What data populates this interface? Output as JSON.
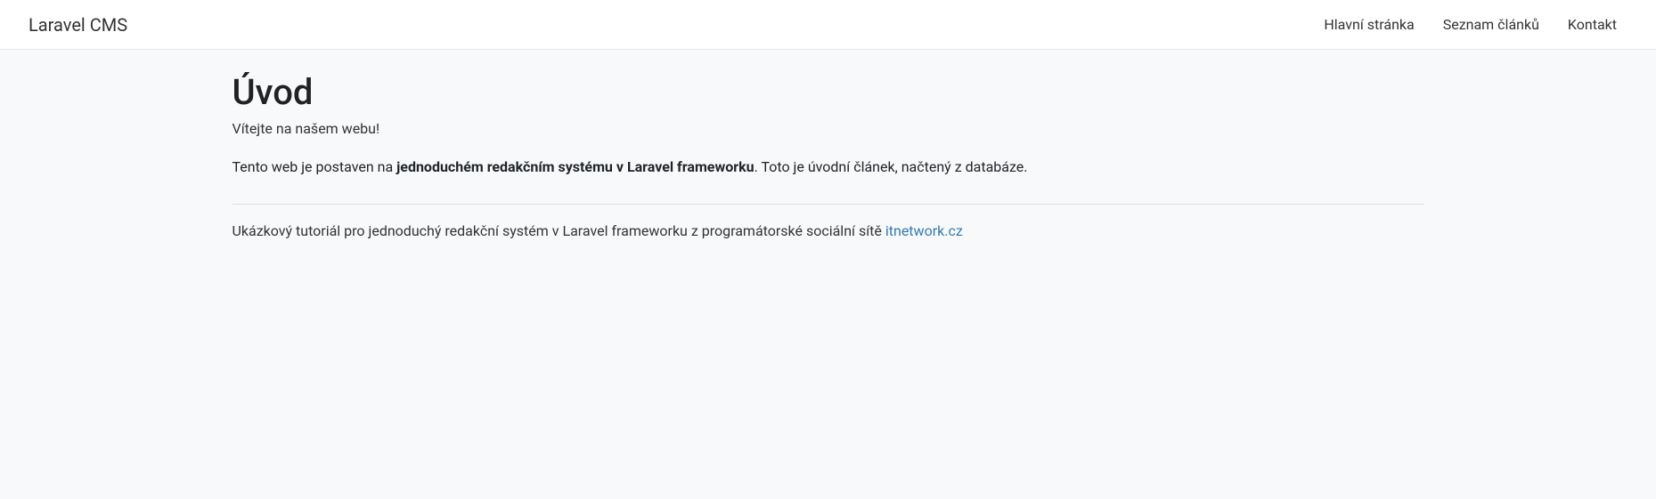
{
  "navbar": {
    "brand": "Laravel CMS",
    "links": [
      {
        "label": "Hlavní stránka"
      },
      {
        "label": "Seznam článků"
      },
      {
        "label": "Kontakt"
      }
    ]
  },
  "article": {
    "title": "Úvod",
    "description": "Vítejte na našem webu!",
    "content_prefix": "Tento web je postaven na ",
    "content_strong": "jednoduchém redakčním systému v Laravel frameworku",
    "content_suffix": ". Toto je úvodní článek, načtený z databáze."
  },
  "footer": {
    "text": "Ukázkový tutoriál pro jednoduchý redakční systém v Laravel frameworku z programátorské sociální sítě ",
    "link_text": "itnetwork.cz"
  }
}
